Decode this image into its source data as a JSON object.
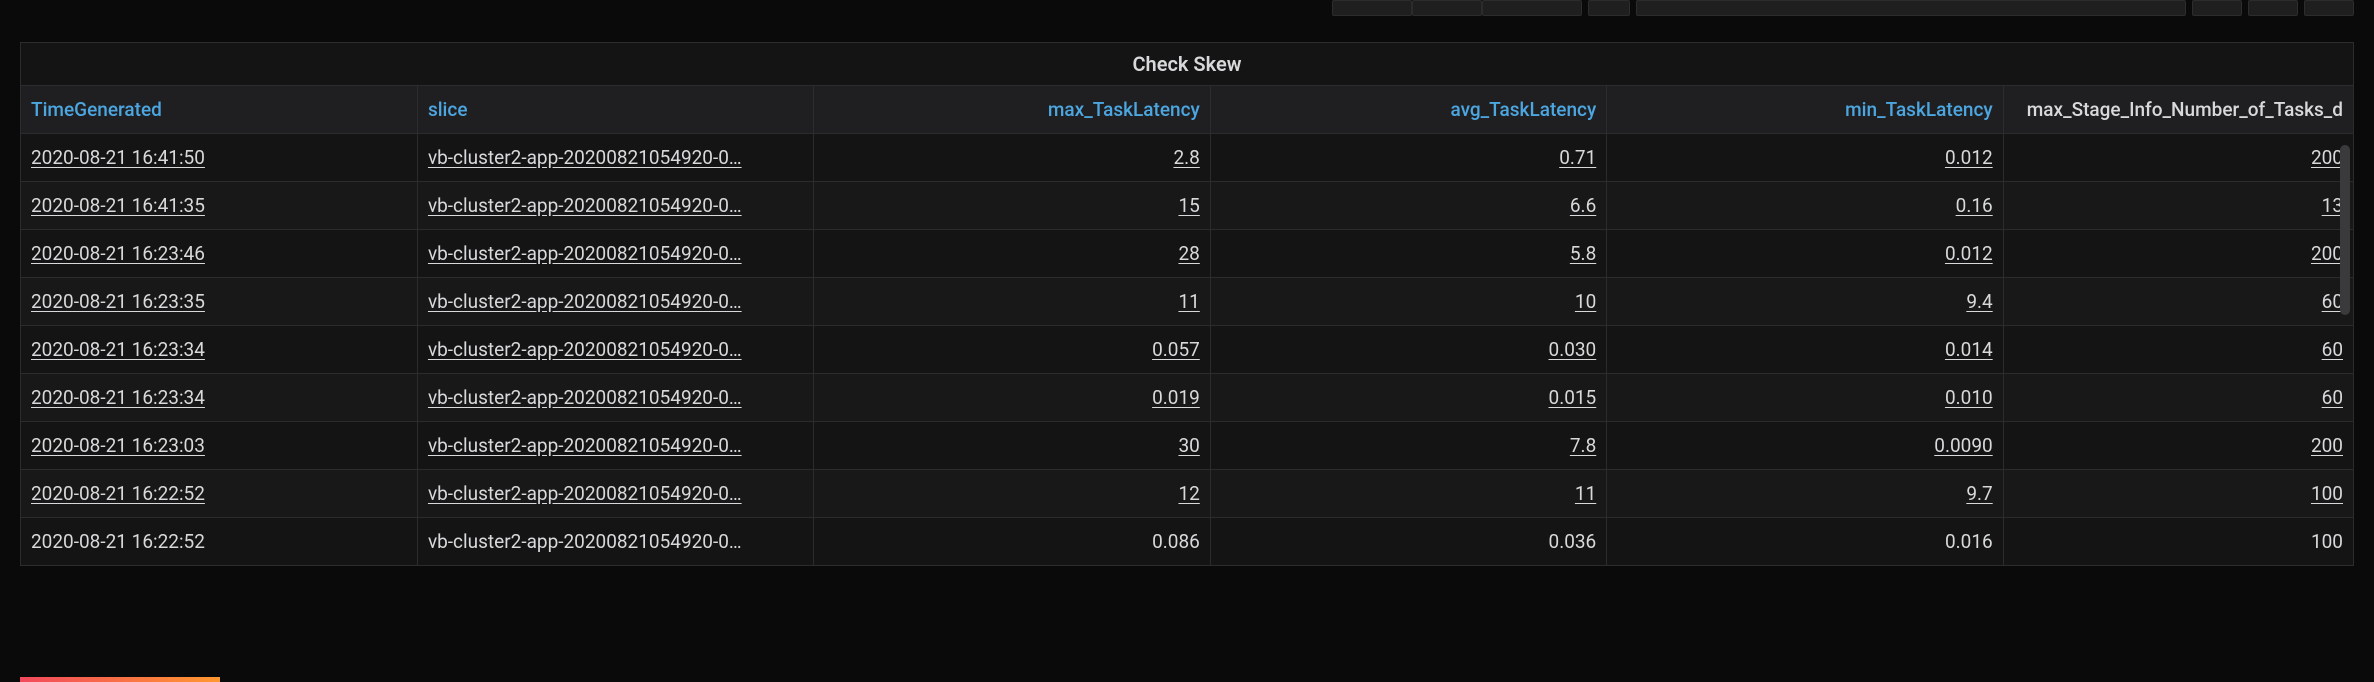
{
  "panel": {
    "title": "Check Skew"
  },
  "columns": {
    "time": "TimeGenerated",
    "slice": "slice",
    "max": "max_TaskLatency",
    "avg": "avg_TaskLatency",
    "min": "min_TaskLatency",
    "tasks": "max_Stage_Info_Number_of_Tasks_d"
  },
  "rows": [
    {
      "time": "2020-08-21 16:41:50",
      "slice": "vb-cluster2-app-20200821054920-0…",
      "max": "2.8",
      "avg": "0.71",
      "min": "0.012",
      "tasks": "200",
      "linked": true
    },
    {
      "time": "2020-08-21 16:41:35",
      "slice": "vb-cluster2-app-20200821054920-0…",
      "max": "15",
      "avg": "6.6",
      "min": "0.16",
      "tasks": "13",
      "linked": true
    },
    {
      "time": "2020-08-21 16:23:46",
      "slice": "vb-cluster2-app-20200821054920-0…",
      "max": "28",
      "avg": "5.8",
      "min": "0.012",
      "tasks": "200",
      "linked": true
    },
    {
      "time": "2020-08-21 16:23:35",
      "slice": "vb-cluster2-app-20200821054920-0…",
      "max": "11",
      "avg": "10",
      "min": "9.4",
      "tasks": "60",
      "linked": true
    },
    {
      "time": "2020-08-21 16:23:34",
      "slice": "vb-cluster2-app-20200821054920-0…",
      "max": "0.057",
      "avg": "0.030",
      "min": "0.014",
      "tasks": "60",
      "linked": true
    },
    {
      "time": "2020-08-21 16:23:34",
      "slice": "vb-cluster2-app-20200821054920-0…",
      "max": "0.019",
      "avg": "0.015",
      "min": "0.010",
      "tasks": "60",
      "linked": true
    },
    {
      "time": "2020-08-21 16:23:03",
      "slice": "vb-cluster2-app-20200821054920-0…",
      "max": "30",
      "avg": "7.8",
      "min": "0.0090",
      "tasks": "200",
      "linked": true
    },
    {
      "time": "2020-08-21 16:22:52",
      "slice": "vb-cluster2-app-20200821054920-0…",
      "max": "12",
      "avg": "11",
      "min": "9.7",
      "tasks": "100",
      "linked": true
    },
    {
      "time": "2020-08-21 16:22:52",
      "slice": "vb-cluster2-app-20200821054920-0…",
      "max": "0.086",
      "avg": "0.036",
      "min": "0.016",
      "tasks": "100",
      "linked": false
    }
  ]
}
